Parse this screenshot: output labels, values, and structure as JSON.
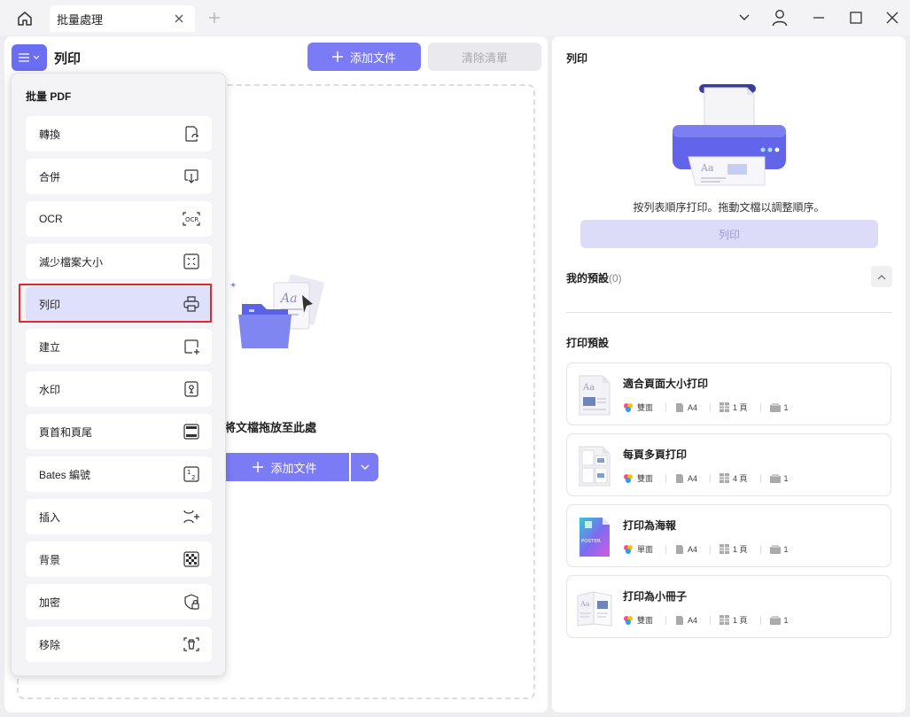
{
  "titlebar": {
    "tab_label": "批量處理"
  },
  "left": {
    "title": "列印",
    "add_file_label": "添加文件",
    "clear_list_label": "清除清單",
    "drop_text": "將文檔拖放至此處",
    "add_file_main_label": "添加文件"
  },
  "menu": {
    "header": "批量 PDF",
    "items": [
      {
        "label": "轉換",
        "icon": "convert-icon"
      },
      {
        "label": "合併",
        "icon": "merge-icon"
      },
      {
        "label": "OCR",
        "icon": "ocr-icon"
      },
      {
        "label": "減少檔案大小",
        "icon": "compress-icon"
      },
      {
        "label": "列印",
        "icon": "print-icon",
        "active": true
      },
      {
        "label": "建立",
        "icon": "create-icon"
      },
      {
        "label": "水印",
        "icon": "watermark-icon"
      },
      {
        "label": "頁首和頁尾",
        "icon": "header-footer-icon"
      },
      {
        "label": "Bates 編號",
        "icon": "bates-number-icon"
      },
      {
        "label": "插入",
        "icon": "insert-icon"
      },
      {
        "label": "背景",
        "icon": "background-icon"
      },
      {
        "label": "加密",
        "icon": "encrypt-icon"
      },
      {
        "label": "移除",
        "icon": "remove-icon"
      }
    ]
  },
  "right": {
    "title": "列印",
    "description": "按列表順序打印。拖動文檔以調整順序。",
    "print_button": "列印",
    "my_presets_label": "我的預設",
    "my_presets_count": "(0)",
    "print_presets_label": "打印預設",
    "presets": [
      {
        "name": "適合頁面大小打印",
        "sides": "雙面",
        "paper": "A4",
        "pages": "1 頁",
        "copies": "1"
      },
      {
        "name": "每頁多頁打印",
        "sides": "雙面",
        "paper": "A4",
        "pages": "4 頁",
        "copies": "1"
      },
      {
        "name": "打印為海報",
        "sides": "單面",
        "paper": "A4",
        "pages": "1 頁",
        "copies": "1",
        "thumb_text": "POSTER"
      },
      {
        "name": "打印為小冊子",
        "sides": "雙面",
        "paper": "A4",
        "pages": "1 頁",
        "copies": "1"
      }
    ]
  },
  "colors": {
    "accent": "#7b7cf5",
    "accent_dark": "#6b6df2",
    "highlight": "#e0282e"
  }
}
